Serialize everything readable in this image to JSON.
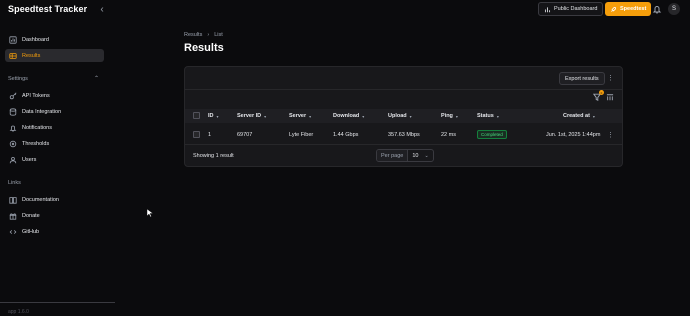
{
  "app": {
    "title": "Speedtest Tracker",
    "version": "app 1.6.0"
  },
  "header": {
    "public_dashboard_label": "Public Dashboard",
    "speedtest_label": "Speedtest",
    "avatar_initial": "S",
    "accent_color": "#f59e0b"
  },
  "sidebar": {
    "items": [
      {
        "label": "Dashboard",
        "icon": "chart-bar-icon"
      },
      {
        "label": "Results",
        "icon": "table-icon",
        "active": true
      }
    ],
    "settings": {
      "label": "Settings",
      "items": [
        {
          "label": "API Tokens",
          "icon": "key-icon"
        },
        {
          "label": "Data Integration",
          "icon": "database-icon"
        },
        {
          "label": "Notifications",
          "icon": "bell-icon"
        },
        {
          "label": "Thresholds",
          "icon": "adjustments-icon"
        },
        {
          "label": "Users",
          "icon": "users-icon"
        }
      ]
    },
    "links": {
      "label": "Links",
      "items": [
        {
          "label": "Documentation",
          "icon": "book-icon"
        },
        {
          "label": "Donate",
          "icon": "gift-icon"
        },
        {
          "label": "GitHub",
          "icon": "code-icon"
        }
      ]
    }
  },
  "main": {
    "breadcrumb": [
      "Results",
      "List"
    ],
    "title": "Results",
    "export_label": "Export results",
    "filter_count": "0",
    "columns": [
      "ID",
      "Server ID",
      "Server",
      "Download",
      "Upload",
      "Ping",
      "Status",
      "Created at"
    ],
    "rows": [
      {
        "id": "1",
        "server_id": "69707",
        "server": "Lyte Fiber",
        "download": "1.44 Gbps",
        "upload": "357.63 Mbps",
        "ping": "22 ms",
        "status": "Completed",
        "created_at": "Jun. 1st, 2025 1:44pm"
      }
    ],
    "showing_text": "Showing 1 result",
    "per_page_label": "Per page",
    "per_page_value": "10"
  }
}
